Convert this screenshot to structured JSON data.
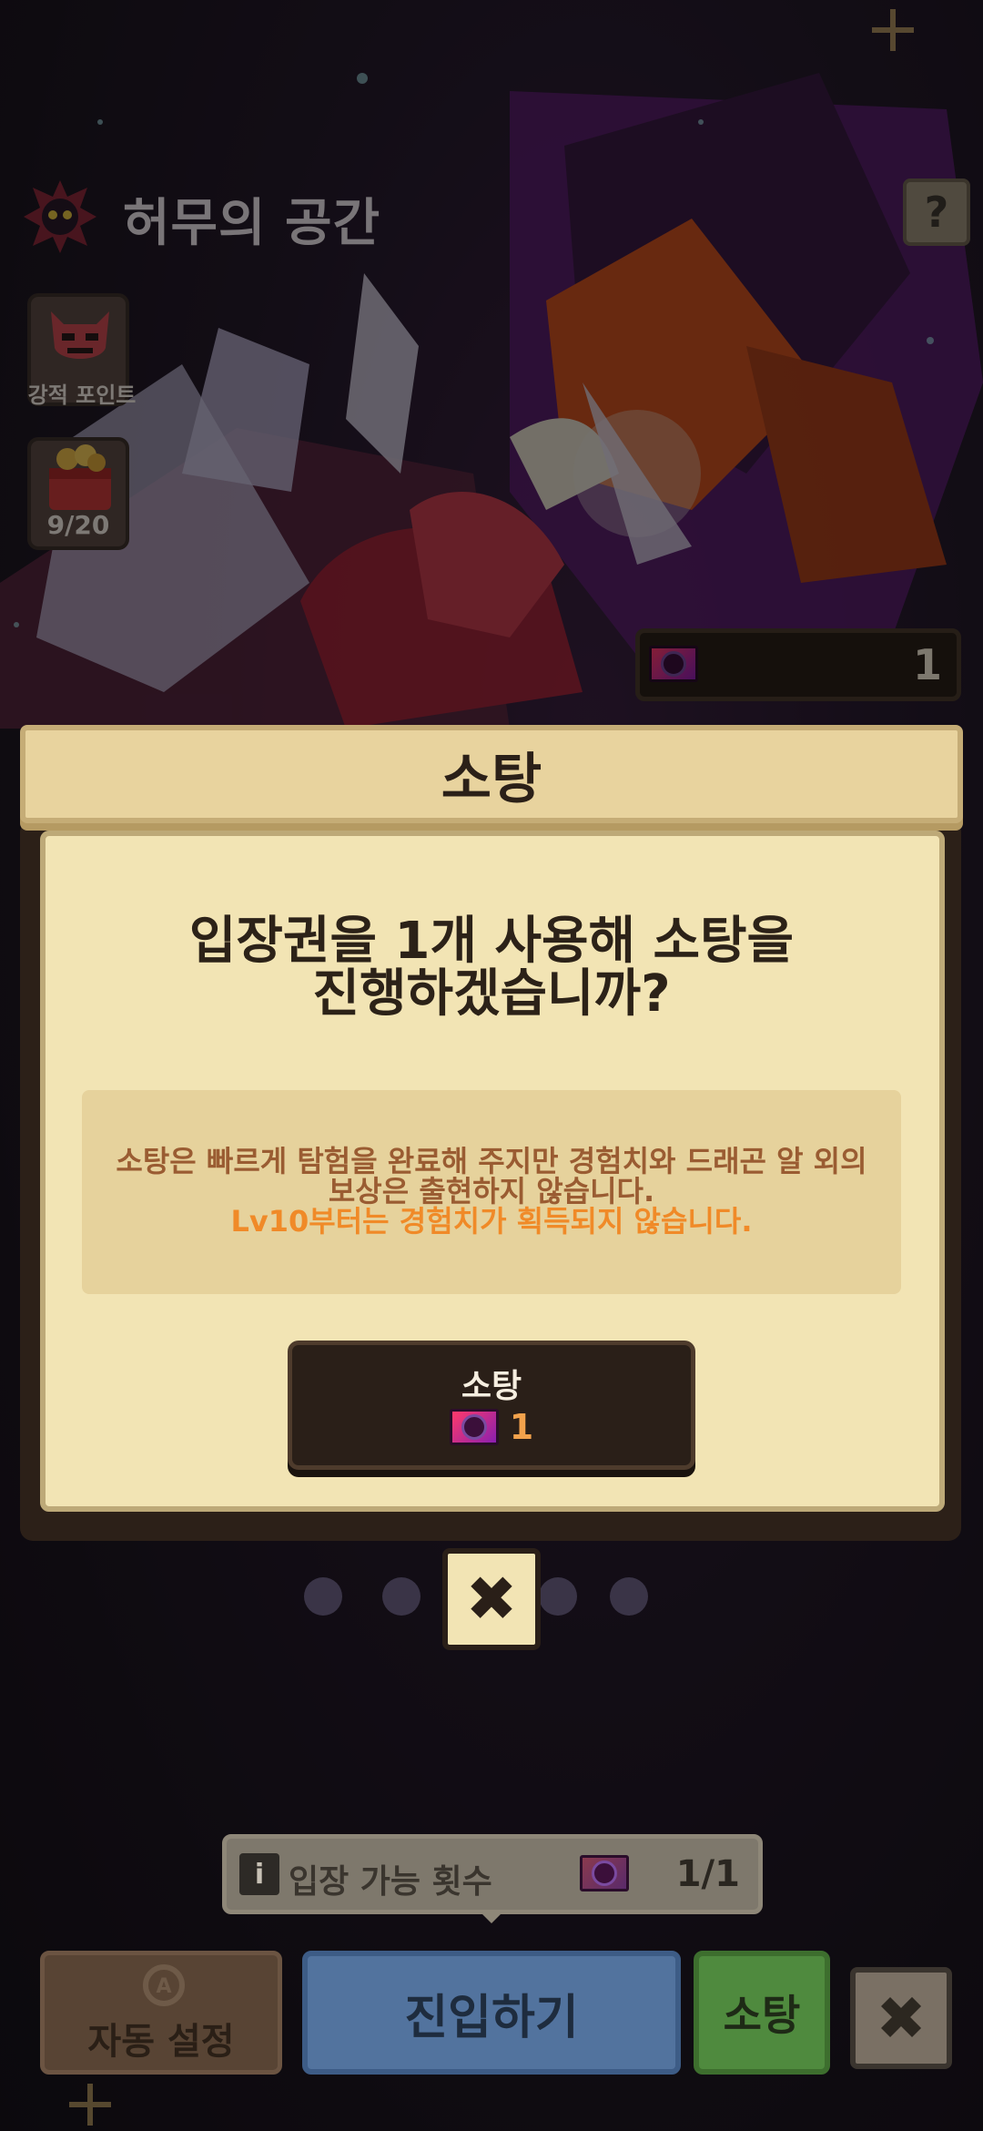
{
  "header": {
    "title": "허무의 공간",
    "help_label": "?"
  },
  "side": {
    "enemy_points_label": "강적 포인트",
    "chest_count": "9/20"
  },
  "ticket_counter": {
    "count": "1"
  },
  "modal": {
    "title": "소탕",
    "question_line1": "입장권을 1개 사용해 소탕을",
    "question_line2": "진행하겠습니까?",
    "notice_line1": "소탕은 빠르게 탐험을 완료해 주지만 경험치와 드래곤 알 외의",
    "notice_line2": "보상은 출현하지 않습니다.",
    "notice_warning": "Lv10부터는 경험치가 획득되지 않습니다.",
    "confirm_label": "소탕",
    "confirm_cost": "1",
    "close_label": "✖"
  },
  "bottom": {
    "info_icon": "i",
    "entry_label": "입장 가능 횟수",
    "entry_count": "1/1",
    "auto_setting_label": "자동 설정",
    "enter_label": "진입하기",
    "sweep_label": "소탕",
    "close_label": "✖"
  },
  "colors": {
    "modal_bg": "#f2e4b4",
    "accent_orange": "#f08a28",
    "notice_brown": "#9a5c32",
    "enter_blue": "#52739e",
    "sweep_green": "#4f8a3e"
  },
  "icons": [
    "skull-emblem-icon",
    "demon-mask-icon",
    "treasure-chest-icon",
    "entry-ticket-icon",
    "info-icon",
    "close-icon"
  ]
}
